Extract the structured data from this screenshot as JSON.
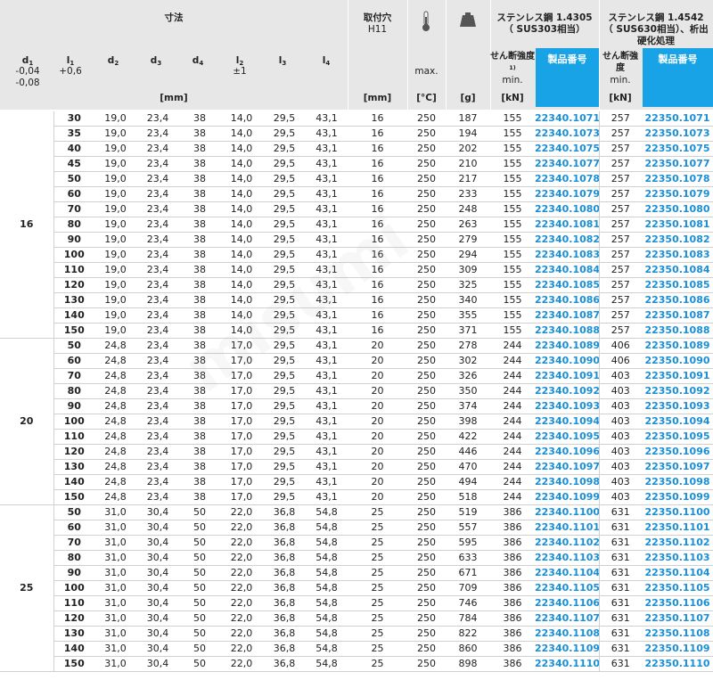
{
  "header": {
    "dimensions": "寸法",
    "mounting_hole": "取付穴",
    "mounting_hole_tol": "H11",
    "stainless1": "ステンレス鋼 1.4305",
    "stainless1_eq": "（ SUS303相当）",
    "stainless2": "ステンレス鋼 1.4542",
    "stainless2_eq": "（ SUS630相当）、析出硬化処理",
    "d1": "d",
    "d1_sub": "1",
    "d1_tol_a": "-0,04",
    "d1_tol_b": "-0,08",
    "l1": "l",
    "l1_sub": "1",
    "l1_tol": "+0,6",
    "d2": "d",
    "d2_sub": "2",
    "d3": "d",
    "d3_sub": "3",
    "d4": "d",
    "d4_sub": "4",
    "l2": "l",
    "l2_sub": "2",
    "l2_tol": "±1",
    "l3": "l",
    "l3_sub": "3",
    "l4": "l",
    "l4_sub": "4",
    "max": "max.",
    "shear1": "せん断強度",
    "shear_sup": "1)",
    "min1": "min.",
    "part_no_1": "製品番号",
    "shear2": "せん断強度",
    "min2": "min.",
    "part_no_2": "製品番号",
    "unit_mm": "[mm]",
    "unit_mm2": "[mm]",
    "unit_c": "[°C]",
    "unit_g": "[g]",
    "unit_kn1": "[kN]",
    "unit_kn2": "[kN]",
    "thermometer_icon": "thermometer-icon",
    "weight_icon": "weight-icon"
  },
  "watermark": "misumi",
  "groups": [
    {
      "d1": "16",
      "rows": [
        [
          "30",
          "19,0",
          "23,4",
          "38",
          "14,0",
          "29,5",
          "43,1",
          "16",
          "250",
          "187",
          "155",
          "22340.1071",
          "257",
          "22350.1071"
        ],
        [
          "35",
          "19,0",
          "23,4",
          "38",
          "14,0",
          "29,5",
          "43,1",
          "16",
          "250",
          "194",
          "155",
          "22340.1073",
          "257",
          "22350.1073"
        ],
        [
          "40",
          "19,0",
          "23,4",
          "38",
          "14,0",
          "29,5",
          "43,1",
          "16",
          "250",
          "202",
          "155",
          "22340.1075",
          "257",
          "22350.1075"
        ],
        [
          "45",
          "19,0",
          "23,4",
          "38",
          "14,0",
          "29,5",
          "43,1",
          "16",
          "250",
          "210",
          "155",
          "22340.1077",
          "257",
          "22350.1077"
        ],
        [
          "50",
          "19,0",
          "23,4",
          "38",
          "14,0",
          "29,5",
          "43,1",
          "16",
          "250",
          "217",
          "155",
          "22340.1078",
          "257",
          "22350.1078"
        ],
        [
          "60",
          "19,0",
          "23,4",
          "38",
          "14,0",
          "29,5",
          "43,1",
          "16",
          "250",
          "233",
          "155",
          "22340.1079",
          "257",
          "22350.1079"
        ],
        [
          "70",
          "19,0",
          "23,4",
          "38",
          "14,0",
          "29,5",
          "43,1",
          "16",
          "250",
          "248",
          "155",
          "22340.1080",
          "257",
          "22350.1080"
        ],
        [
          "80",
          "19,0",
          "23,4",
          "38",
          "14,0",
          "29,5",
          "43,1",
          "16",
          "250",
          "263",
          "155",
          "22340.1081",
          "257",
          "22350.1081"
        ],
        [
          "90",
          "19,0",
          "23,4",
          "38",
          "14,0",
          "29,5",
          "43,1",
          "16",
          "250",
          "279",
          "155",
          "22340.1082",
          "257",
          "22350.1082"
        ],
        [
          "100",
          "19,0",
          "23,4",
          "38",
          "14,0",
          "29,5",
          "43,1",
          "16",
          "250",
          "294",
          "155",
          "22340.1083",
          "257",
          "22350.1083"
        ],
        [
          "110",
          "19,0",
          "23,4",
          "38",
          "14,0",
          "29,5",
          "43,1",
          "16",
          "250",
          "309",
          "155",
          "22340.1084",
          "257",
          "22350.1084"
        ],
        [
          "120",
          "19,0",
          "23,4",
          "38",
          "14,0",
          "29,5",
          "43,1",
          "16",
          "250",
          "325",
          "155",
          "22340.1085",
          "257",
          "22350.1085"
        ],
        [
          "130",
          "19,0",
          "23,4",
          "38",
          "14,0",
          "29,5",
          "43,1",
          "16",
          "250",
          "340",
          "155",
          "22340.1086",
          "257",
          "22350.1086"
        ],
        [
          "140",
          "19,0",
          "23,4",
          "38",
          "14,0",
          "29,5",
          "43,1",
          "16",
          "250",
          "355",
          "155",
          "22340.1087",
          "257",
          "22350.1087"
        ],
        [
          "150",
          "19,0",
          "23,4",
          "38",
          "14,0",
          "29,5",
          "43,1",
          "16",
          "250",
          "371",
          "155",
          "22340.1088",
          "257",
          "22350.1088"
        ]
      ]
    },
    {
      "d1": "20",
      "rows": [
        [
          "50",
          "24,8",
          "23,4",
          "38",
          "17,0",
          "29,5",
          "43,1",
          "20",
          "250",
          "278",
          "244",
          "22340.1089",
          "406",
          "22350.1089"
        ],
        [
          "60",
          "24,8",
          "23,4",
          "38",
          "17,0",
          "29,5",
          "43,1",
          "20",
          "250",
          "302",
          "244",
          "22340.1090",
          "406",
          "22350.1090"
        ],
        [
          "70",
          "24,8",
          "23,4",
          "38",
          "17,0",
          "29,5",
          "43,1",
          "20",
          "250",
          "326",
          "244",
          "22340.1091",
          "403",
          "22350.1091"
        ],
        [
          "80",
          "24,8",
          "23,4",
          "38",
          "17,0",
          "29,5",
          "43,1",
          "20",
          "250",
          "350",
          "244",
          "22340.1092",
          "403",
          "22350.1092"
        ],
        [
          "90",
          "24,8",
          "23,4",
          "38",
          "17,0",
          "29,5",
          "43,1",
          "20",
          "250",
          "374",
          "244",
          "22340.1093",
          "403",
          "22350.1093"
        ],
        [
          "100",
          "24,8",
          "23,4",
          "38",
          "17,0",
          "29,5",
          "43,1",
          "20",
          "250",
          "398",
          "244",
          "22340.1094",
          "403",
          "22350.1094"
        ],
        [
          "110",
          "24,8",
          "23,4",
          "38",
          "17,0",
          "29,5",
          "43,1",
          "20",
          "250",
          "422",
          "244",
          "22340.1095",
          "403",
          "22350.1095"
        ],
        [
          "120",
          "24,8",
          "23,4",
          "38",
          "17,0",
          "29,5",
          "43,1",
          "20",
          "250",
          "446",
          "244",
          "22340.1096",
          "403",
          "22350.1096"
        ],
        [
          "130",
          "24,8",
          "23,4",
          "38",
          "17,0",
          "29,5",
          "43,1",
          "20",
          "250",
          "470",
          "244",
          "22340.1097",
          "403",
          "22350.1097"
        ],
        [
          "140",
          "24,8",
          "23,4",
          "38",
          "17,0",
          "29,5",
          "43,1",
          "20",
          "250",
          "494",
          "244",
          "22340.1098",
          "403",
          "22350.1098"
        ],
        [
          "150",
          "24,8",
          "23,4",
          "38",
          "17,0",
          "29,5",
          "43,1",
          "20",
          "250",
          "518",
          "244",
          "22340.1099",
          "403",
          "22350.1099"
        ]
      ]
    },
    {
      "d1": "25",
      "rows": [
        [
          "50",
          "31,0",
          "30,4",
          "50",
          "22,0",
          "36,8",
          "54,8",
          "25",
          "250",
          "519",
          "386",
          "22340.1100",
          "631",
          "22350.1100"
        ],
        [
          "60",
          "31,0",
          "30,4",
          "50",
          "22,0",
          "36,8",
          "54,8",
          "25",
          "250",
          "557",
          "386",
          "22340.1101",
          "631",
          "22350.1101"
        ],
        [
          "70",
          "31,0",
          "30,4",
          "50",
          "22,0",
          "36,8",
          "54,8",
          "25",
          "250",
          "595",
          "386",
          "22340.1102",
          "631",
          "22350.1102"
        ],
        [
          "80",
          "31,0",
          "30,4",
          "50",
          "22,0",
          "36,8",
          "54,8",
          "25",
          "250",
          "633",
          "386",
          "22340.1103",
          "631",
          "22350.1103"
        ],
        [
          "90",
          "31,0",
          "30,4",
          "50",
          "22,0",
          "36,8",
          "54,8",
          "25",
          "250",
          "671",
          "386",
          "22340.1104",
          "631",
          "22350.1104"
        ],
        [
          "100",
          "31,0",
          "30,4",
          "50",
          "22,0",
          "36,8",
          "54,8",
          "25",
          "250",
          "709",
          "386",
          "22340.1105",
          "631",
          "22350.1105"
        ],
        [
          "110",
          "31,0",
          "30,4",
          "50",
          "22,0",
          "36,8",
          "54,8",
          "25",
          "250",
          "746",
          "386",
          "22340.1106",
          "631",
          "22350.1106"
        ],
        [
          "120",
          "31,0",
          "30,4",
          "50",
          "22,0",
          "36,8",
          "54,8",
          "25",
          "250",
          "784",
          "386",
          "22340.1107",
          "631",
          "22350.1107"
        ],
        [
          "130",
          "31,0",
          "30,4",
          "50",
          "22,0",
          "36,8",
          "54,8",
          "25",
          "250",
          "822",
          "386",
          "22340.1108",
          "631",
          "22350.1108"
        ],
        [
          "140",
          "31,0",
          "30,4",
          "50",
          "22,0",
          "36,8",
          "54,8",
          "25",
          "250",
          "860",
          "386",
          "22340.1109",
          "631",
          "22350.1109"
        ],
        [
          "150",
          "31,0",
          "30,4",
          "50",
          "22,0",
          "36,8",
          "54,8",
          "25",
          "250",
          "898",
          "386",
          "22340.1110",
          "631",
          "22350.1110"
        ]
      ]
    }
  ]
}
